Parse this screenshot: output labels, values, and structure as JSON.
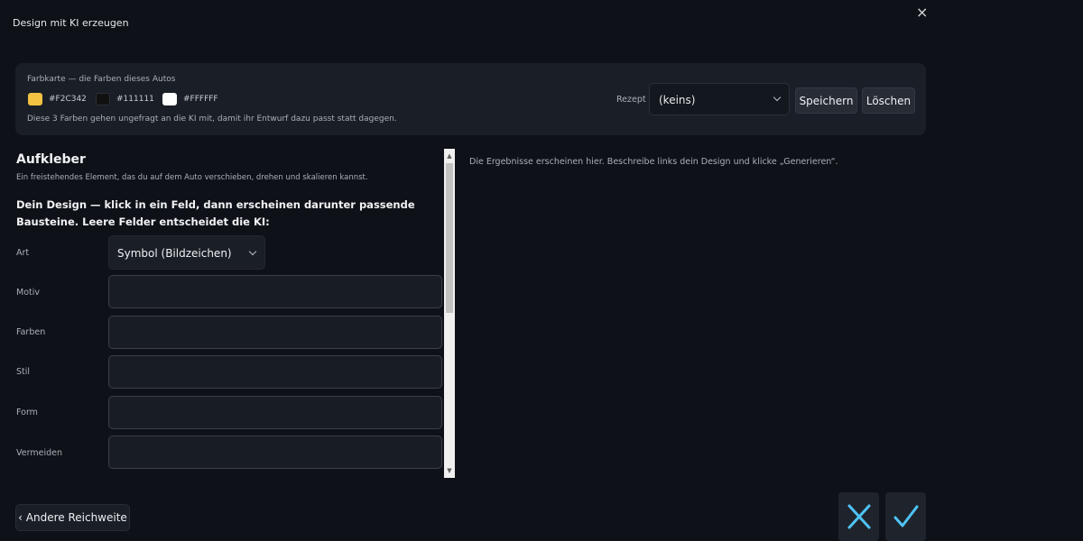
{
  "window": {
    "title": "Design mit KI erzeugen",
    "close_glyph": "×"
  },
  "color_card": {
    "label": "Farbkarte — die Farben dieses Autos",
    "colors": [
      {
        "hex": "#F2C342",
        "label": "#F2C342"
      },
      {
        "hex": "#111111",
        "label": "#111111"
      },
      {
        "hex": "#FFFFFF",
        "label": "#FFFFFF"
      }
    ],
    "note": "Diese 3 Farben gehen ungefragt an die KI mit, damit ihr Entwurf dazu passt statt dagegen.",
    "rezept_label": "Rezept",
    "rezept_value": "(keins)",
    "save_label": "Speichern",
    "delete_label": "Löschen"
  },
  "left_panel": {
    "title": "Aufkleber",
    "subtitle": "Ein freistehendes Element, das du auf dem Auto verschieben, drehen und skalieren kannst.",
    "design_heading": "Dein Design — klick in ein Feld, dann erscheinen darunter passende Bausteine. Leere Felder entscheidet die KI:",
    "fields": {
      "art": {
        "label": "Art",
        "value": "Symbol (Bildzeichen)"
      },
      "motiv": {
        "label": "Motiv",
        "value": ""
      },
      "farben": {
        "label": "Farben",
        "value": ""
      },
      "stil": {
        "label": "Stil",
        "value": ""
      },
      "form": {
        "label": "Form",
        "value": ""
      },
      "vermeiden": {
        "label": "Vermeiden",
        "value": ""
      }
    }
  },
  "results": {
    "placeholder": "Die Ergebnisse erscheinen hier. Beschreibe links dein Design und klicke „Generieren“."
  },
  "footer": {
    "back_label": "‹ Andere Reichweite"
  },
  "icons": {
    "cancel": "x-icon",
    "confirm": "checkmark-icon",
    "accent": "#4fc3f7"
  }
}
